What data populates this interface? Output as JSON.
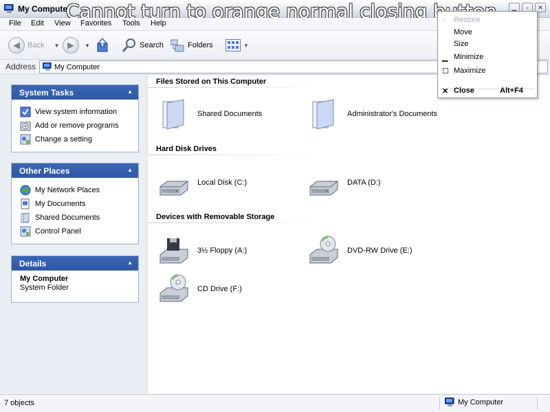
{
  "window": {
    "title": "My Computer",
    "overlay_caption": "Cannot turn to orange normal closing button",
    "caption_buttons": [
      "minimize-icon",
      "maximize-icon",
      "close-icon"
    ]
  },
  "menu": [
    "File",
    "Edit",
    "View",
    "Favorites",
    "Tools",
    "Help"
  ],
  "toolbar": {
    "back": "Back",
    "search": "Search",
    "folders": "Folders"
  },
  "address": {
    "label": "Address",
    "value": "My Computer"
  },
  "system_tasks": {
    "title": "System Tasks",
    "items": [
      {
        "label": "View system information",
        "icon": "system-info-icon"
      },
      {
        "label": "Add or remove programs",
        "icon": "add-remove-programs-icon"
      },
      {
        "label": "Change a setting",
        "icon": "control-panel-icon"
      }
    ]
  },
  "other_places": {
    "title": "Other Places",
    "items": [
      {
        "label": "My Network Places",
        "icon": "network-places-icon"
      },
      {
        "label": "My Documents",
        "icon": "documents-icon"
      },
      {
        "label": "Shared Documents",
        "icon": "folder-icon"
      },
      {
        "label": "Control Panel",
        "icon": "control-panel-icon"
      }
    ]
  },
  "details": {
    "title": "Details",
    "name": "My Computer",
    "type": "System Folder"
  },
  "groups": [
    {
      "title": "Files Stored on This Computer",
      "items": [
        {
          "label": "Shared Documents",
          "icon": "folder-icon"
        },
        {
          "label": "Administrator's Documents",
          "icon": "folder-icon"
        }
      ]
    },
    {
      "title": "Hard Disk Drives",
      "items": [
        {
          "label": "Local Disk (C:)",
          "icon": "hard-disk-icon"
        },
        {
          "label": "DATA (D:)",
          "icon": "hard-disk-icon"
        }
      ]
    },
    {
      "title": "Devices with Removable Storage",
      "items": [
        {
          "label": "3½ Floppy (A:)",
          "icon": "floppy-drive-icon"
        },
        {
          "label": "DVD-RW Drive (E:)",
          "icon": "dvd-drive-icon"
        },
        {
          "label": "CD Drive (F:)",
          "icon": "cd-drive-icon"
        }
      ]
    }
  ],
  "status": {
    "objects": "7 objects",
    "location": "My Computer"
  },
  "system_menu": {
    "items": [
      {
        "label": "Restore",
        "disabled": true
      },
      {
        "label": "Move"
      },
      {
        "label": "Size"
      },
      {
        "label": "Minimize"
      },
      {
        "label": "Maximize"
      },
      {
        "label": "Close",
        "shortcut": "Alt+F4",
        "bold": true
      }
    ]
  },
  "colors": {
    "panel_header": "#2f58a6",
    "left_pane_bg": "#eaeef5"
  }
}
